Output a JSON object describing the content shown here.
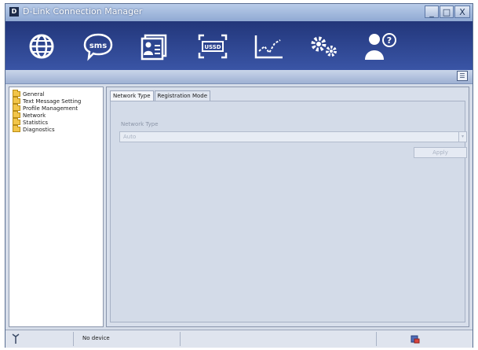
{
  "window": {
    "title": "D-Link Connection Manager",
    "buttons": {
      "minimize": "_",
      "maximize": "□",
      "close": "X"
    }
  },
  "toolbar": {
    "items": [
      {
        "name": "internet",
        "icon": "globe-icon"
      },
      {
        "name": "sms",
        "icon": "sms-bubble-icon",
        "text": "sms"
      },
      {
        "name": "profile",
        "icon": "contact-card-icon"
      },
      {
        "name": "ussd",
        "icon": "ussd-icon",
        "text": "USSD"
      },
      {
        "name": "statistics",
        "icon": "line-chart-icon"
      },
      {
        "name": "settings",
        "icon": "gears-icon"
      },
      {
        "name": "help",
        "icon": "user-help-icon"
      }
    ]
  },
  "sidebar": {
    "items": [
      {
        "label": "General"
      },
      {
        "label": "Text Message Setting"
      },
      {
        "label": "Profile Management"
      },
      {
        "label": "Network"
      },
      {
        "label": "Statistics"
      },
      {
        "label": "Diagnostics"
      }
    ]
  },
  "tabs": [
    {
      "label": "Network Type",
      "active": true
    },
    {
      "label": "Registration Mode",
      "active": false
    }
  ],
  "network_type": {
    "label": "Network Type",
    "value": "Auto",
    "apply_label": "Apply"
  },
  "status": {
    "text": "No device"
  },
  "colors": {
    "toolbar": "#22367a",
    "titlebar": "#8fa9d3",
    "folder": "#f2c548"
  }
}
